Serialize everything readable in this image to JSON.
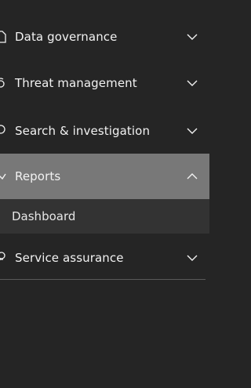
{
  "nav": {
    "items": [
      {
        "label": "Data governance",
        "icon": "document-icon",
        "expanded": false
      },
      {
        "label": "Threat management",
        "icon": "biohazard-icon",
        "expanded": false
      },
      {
        "label": "Search & investigation",
        "icon": "search-icon",
        "expanded": false
      },
      {
        "label": "Reports",
        "icon": "chart-icon",
        "expanded": true,
        "children": [
          {
            "label": "Dashboard"
          }
        ]
      },
      {
        "label": "Service assurance",
        "icon": "person-icon",
        "expanded": false
      }
    ]
  },
  "colors": {
    "background": "#252525",
    "selected": "#787878",
    "submenu": "#333333",
    "text": "#f2f2f2",
    "divider": "#5a5a5a"
  }
}
